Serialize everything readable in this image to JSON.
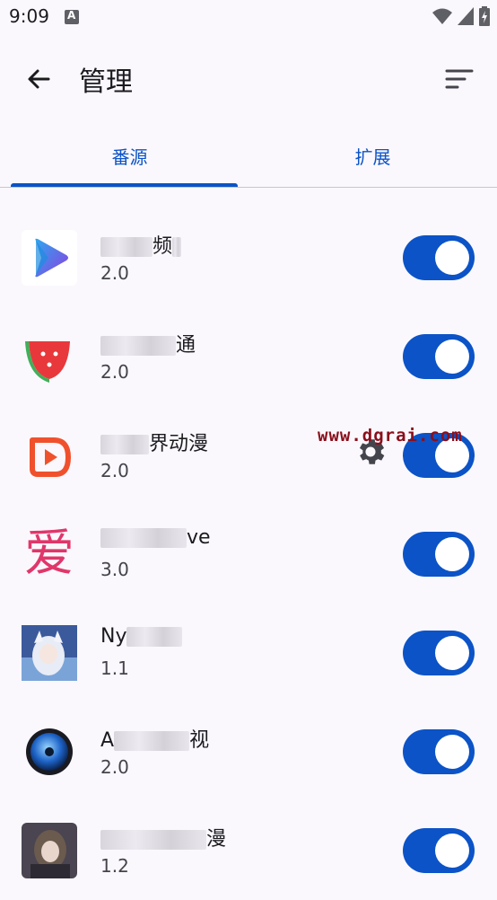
{
  "status": {
    "time": "9:09"
  },
  "appbar": {
    "title": "管理"
  },
  "tabs": [
    {
      "label": "番源"
    },
    {
      "label": "扩展"
    }
  ],
  "sources": [
    {
      "name_prefix": "",
      "name_suffix": "频",
      "version": "2.0",
      "enabled": true,
      "icon": "play-triangle-icon"
    },
    {
      "name_prefix": "",
      "name_suffix": "通",
      "version": "2.0",
      "enabled": true,
      "icon": "watermelon-icon"
    },
    {
      "name_prefix": "",
      "name_suffix": "界动漫",
      "version": "2.0",
      "enabled": true,
      "icon": "orange-play-icon"
    },
    {
      "name_prefix": "",
      "name_suffix": "ve",
      "version": "3.0",
      "enabled": true,
      "icon": "love-character-icon"
    },
    {
      "name_prefix": "Ny",
      "name_suffix": "",
      "version": "1.1",
      "enabled": true,
      "icon": "anime-girl-icon"
    },
    {
      "name_prefix": "A",
      "name_suffix": "视",
      "version": "2.0",
      "enabled": true,
      "icon": "disc-icon"
    },
    {
      "name_prefix": "",
      "name_suffix": "漫",
      "version": "1.2",
      "enabled": true,
      "icon": "anime-portrait-icon"
    }
  ],
  "icon_glyphs": {
    "love": "爱"
  },
  "watermark": "www.dgrai.com",
  "colors": {
    "accent": "#0b53c7",
    "background": "#fbf8fd"
  }
}
